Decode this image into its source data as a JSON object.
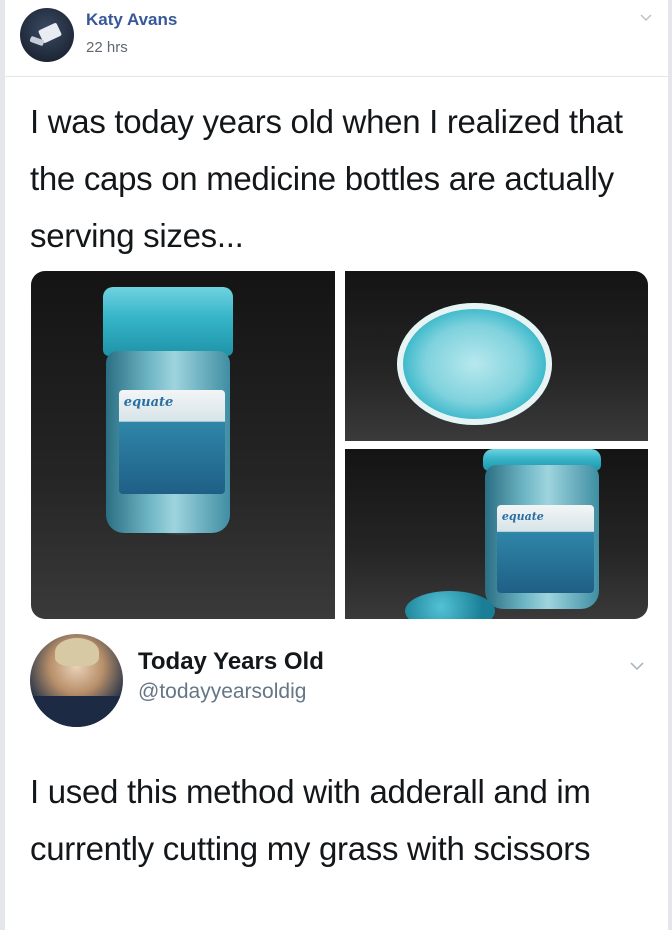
{
  "post": {
    "author_name": "Katy Avans",
    "timestamp": "22 hrs"
  },
  "tweet1": {
    "text": "I was today years old when I realized that the caps on medicine bottles are actually serving sizes...",
    "photos": [
      {
        "brand": "equate"
      },
      {
        "brand": ""
      },
      {
        "brand": "equate"
      }
    ]
  },
  "tweet2": {
    "display_name": "Today Years Old",
    "handle": "@todayyearsoldig",
    "text": "I used this method with adderall and im currently cutting my grass with scissors"
  },
  "colors": {
    "link_blue": "#385898",
    "cap_teal": "#35b4c8",
    "text_dark": "#14171a",
    "muted_gray": "#657786"
  }
}
